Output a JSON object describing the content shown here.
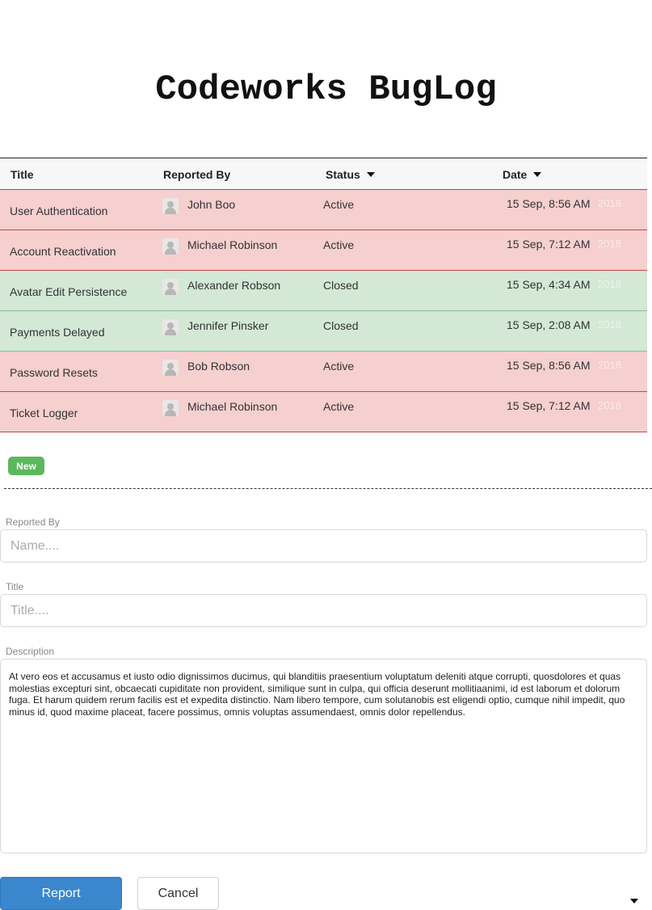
{
  "app": {
    "title": "Codeworks BugLog"
  },
  "table": {
    "headers": {
      "title": "Title",
      "reported_by": "Reported By",
      "status": "Status",
      "date": "Date"
    },
    "rows": [
      {
        "title": "User Authentication",
        "reported_by": "John Boo",
        "status": "Active",
        "date": "15 Sep, 8:56 AM",
        "year": "2018"
      },
      {
        "title": "Account Reactivation",
        "reported_by": "Michael Robinson",
        "status": "Active",
        "date": "15 Sep, 7:12 AM",
        "year": "2018"
      },
      {
        "title": "Avatar Edit Persistence",
        "reported_by": "Alexander Robson",
        "status": "Closed",
        "date": "15 Sep, 4:34 AM",
        "year": "2018"
      },
      {
        "title": "Payments Delayed",
        "reported_by": "Jennifer Pinsker",
        "status": "Closed",
        "date": "15 Sep, 2:08 AM",
        "year": "2018"
      },
      {
        "title": "Password Resets",
        "reported_by": "Bob Robson",
        "status": "Active",
        "date": "15 Sep, 8:56 AM",
        "year": "2018"
      },
      {
        "title": "Ticket Logger",
        "reported_by": "Michael Robinson",
        "status": "Active",
        "date": "15 Sep, 7:12 AM",
        "year": "2018"
      }
    ]
  },
  "actions": {
    "new_label": "New"
  },
  "form": {
    "reported_by_label": "Reported By",
    "reported_by_placeholder": "Name....",
    "title_label": "Title",
    "title_placeholder": "Title....",
    "description_label": "Description",
    "description_value": "At vero eos et accusamus et iusto odio dignissimos ducimus, qui blanditiis praesentium voluptatum deleniti atque corrupti, quosdolores et quas molestias excepturi sint, obcaecati cupiditate non provident, similique sunt in culpa, qui officia deserunt mollitiaanimi, id est laborum et dolorum fuga. Et harum quidem rerum facilis est et expedita distinctio. Nam libero tempore, cum solutanobis est eligendi optio, cumque nihil impedit, quo minus id, quod maxime placeat, facere possimus, omnis voluptas assumendaest, omnis dolor repellendus.",
    "report_label": "Report",
    "cancel_label": "Cancel"
  },
  "colors": {
    "active_row": "#f6cfcf",
    "closed_row": "#d3e8d5",
    "primary_button": "#3b87cd",
    "new_button": "#5cb85c"
  },
  "icons": {
    "row_avatar": "user-avatar-icon",
    "sort": "caret-down-icon"
  }
}
